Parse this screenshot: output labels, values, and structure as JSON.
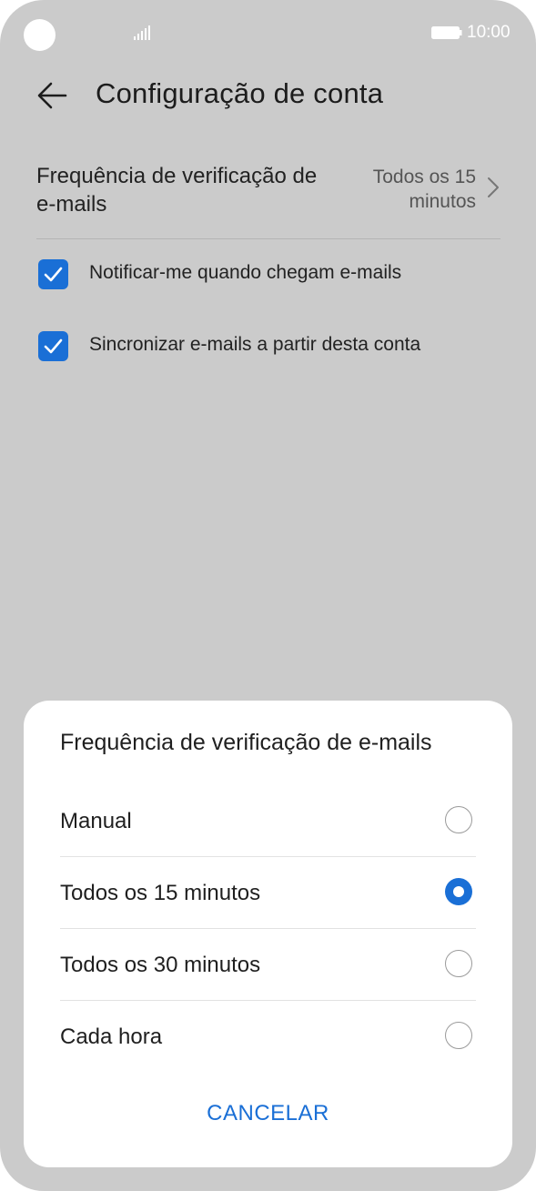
{
  "status_bar": {
    "time": "10:00",
    "signal_icon": "signal-icon",
    "battery_icon": "battery-icon"
  },
  "header": {
    "title": "Configuração de conta",
    "back_icon": "arrow-left-icon"
  },
  "settings": {
    "frequency": {
      "label": "Frequência de verificação de e-mails",
      "value": "Todos os 15 minutos"
    },
    "checkboxes": [
      {
        "label": "Notificar-me quando chegam e-mails",
        "checked": true
      },
      {
        "label": "Sincronizar e-mails a partir desta conta",
        "checked": true
      }
    ]
  },
  "dialog": {
    "title": "Frequência de verificação de e-mails",
    "options": [
      {
        "label": "Manual",
        "selected": false
      },
      {
        "label": "Todos os 15 minutos",
        "selected": true
      },
      {
        "label": "Todos os 30 minutos",
        "selected": false
      },
      {
        "label": "Cada hora",
        "selected": false
      }
    ],
    "cancel_label": "CANCELAR"
  },
  "colors": {
    "accent": "#1a6fd6",
    "scrim": "#cbcbcb",
    "dialog_bg": "#ffffff"
  }
}
